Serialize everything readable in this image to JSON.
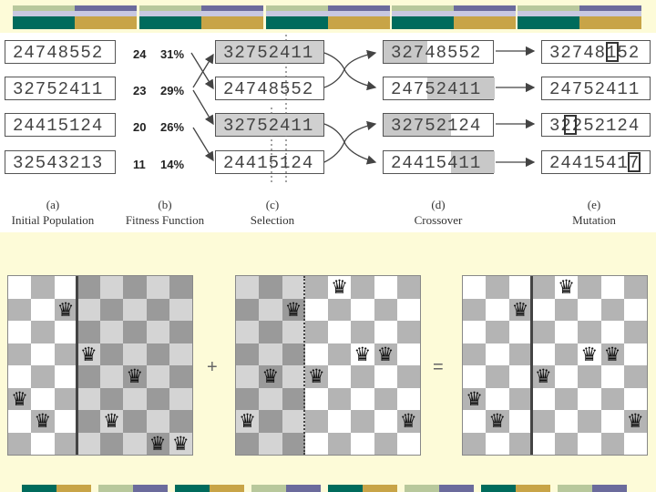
{
  "colors": {
    "teal": "#006b5c",
    "gold": "#c8a447",
    "purple": "#6b6b9c",
    "sage": "#b8c89c",
    "lavender": "#c8c8e0",
    "cream": "#fdfbd8"
  },
  "pipeline": {
    "population": [
      "24748552",
      "32752411",
      "24415124",
      "32543213"
    ],
    "fitness": [
      {
        "score": "24",
        "pct": "31%"
      },
      {
        "score": "23",
        "pct": "29%"
      },
      {
        "score": "20",
        "pct": "26%"
      },
      {
        "score": "11",
        "pct": "14%"
      }
    ],
    "selection": [
      "32752411",
      "24748552",
      "32752411",
      "24415124"
    ],
    "crossover": [
      "32748552",
      "24752411",
      "32752124",
      "24415411"
    ],
    "mutation": [
      "32748152",
      "24752411",
      "32252124",
      "24415417"
    ],
    "labels": {
      "a": "(a)",
      "a_name": "Initial Population",
      "b": "(b)",
      "b_name": "Fitness Function",
      "c": "(c)",
      "c_name": "Selection",
      "d": "(d)",
      "d_name": "Crossover",
      "e": "(e)",
      "e_name": "Mutation"
    }
  },
  "boards": {
    "plus": "+",
    "equals": "=",
    "queen_glyph": "♛"
  }
}
